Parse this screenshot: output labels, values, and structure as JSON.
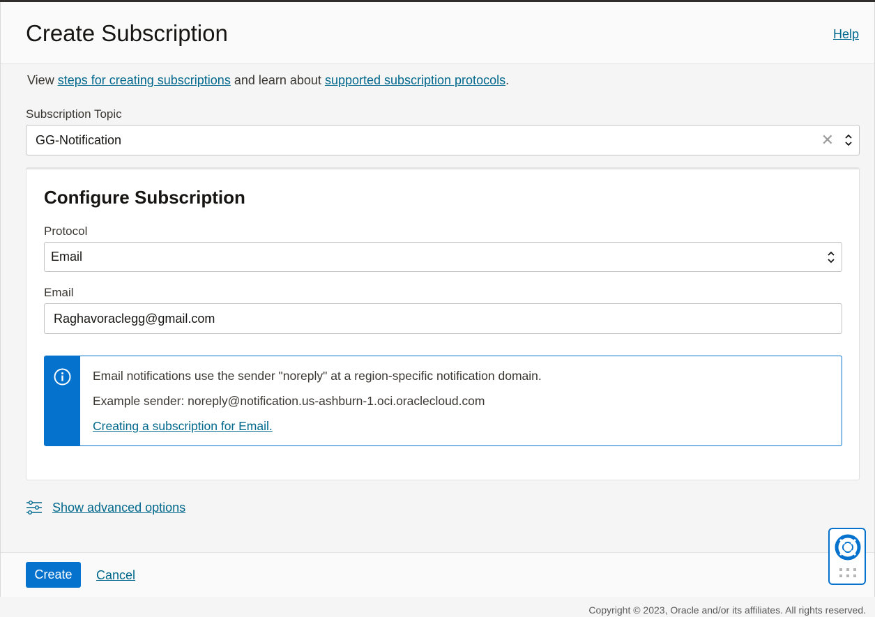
{
  "header": {
    "title": "Create Subscription",
    "help_label": "Help"
  },
  "intro": {
    "prefix": "View ",
    "link1": "steps for creating subscriptions",
    "middle": " and learn about ",
    "link2": "supported subscription protocols",
    "suffix": "."
  },
  "topic": {
    "label": "Subscription Topic",
    "value": "GG-Notification",
    "clear_icon": "close-icon"
  },
  "configure": {
    "title": "Configure Subscription",
    "protocol_label": "Protocol",
    "protocol_value": "Email",
    "email_label": "Email",
    "email_value": "Raghavoraclegg@gmail.com"
  },
  "info": {
    "icon": "info-icon",
    "line1": "Email notifications use the sender \"noreply\" at a region-specific notification domain.",
    "line2": "Example sender: noreply@notification.us-ashburn-1.oci.oraclecloud.com",
    "link": "Creating a subscription for Email."
  },
  "advanced": {
    "label": "Show advanced options",
    "icon": "sliders-icon"
  },
  "footer": {
    "create_label": "Create",
    "cancel_label": "Cancel"
  },
  "help_widget": {
    "icon": "lifebuoy-icon"
  },
  "copyright": "Copyright © 2023, Oracle and/or its affiliates. All rights reserved.",
  "colors": {
    "accent": "#0572ce",
    "link": "#00688c",
    "text": "#161513"
  }
}
